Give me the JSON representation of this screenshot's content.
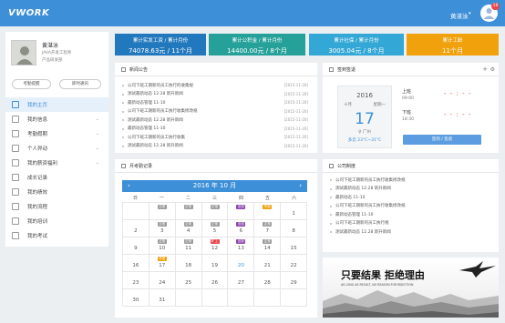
{
  "app": {
    "logo": "VWORK",
    "username": "黄湛泳",
    "notification_count": "18"
  },
  "profile": {
    "name": "黄湛泳",
    "line1": "JAVA开发工程师",
    "line2": "产品研发部",
    "btn_reminder": "考勤提醒",
    "btn_notice": "即时通讯"
  },
  "sidebar": {
    "items": [
      {
        "label": "我的主页",
        "active": true
      },
      {
        "label": "我的信息",
        "chevron": true
      },
      {
        "label": "考勤假期",
        "chevron": true
      },
      {
        "label": "个人异动",
        "chevron": true
      },
      {
        "label": "我的薪资福利",
        "chevron": true
      },
      {
        "label": "成长记录",
        "chevron": false
      },
      {
        "label": "我的绩效",
        "chevron": false
      },
      {
        "label": "我的流程",
        "chevron": false
      },
      {
        "label": "我的培训",
        "chevron": false
      },
      {
        "label": "我的考试",
        "chevron": false
      }
    ]
  },
  "stats": [
    {
      "title": "累计实发工资 / 累计月份",
      "value": "74078.63元 / 11个月",
      "color": "#2178bd"
    },
    {
      "title": "累计公积金 / 累计月份",
      "value": "14400.00元 / 8个月",
      "color": "#26a19a"
    },
    {
      "title": "累计社保 / 累计月份",
      "value": "3005.04元 / 8个月",
      "color": "#33a7d5"
    },
    {
      "title": "累计工龄",
      "value": "11个月",
      "color": "#f0a10c"
    }
  ],
  "news_panel": {
    "title": "新闻公告",
    "items": [
      {
        "text": "公司下班工期新的员工执行的收集规",
        "date": "[2015-11-20]"
      },
      {
        "text": "测试最新动态 12.28 新升新闻",
        "date": "[2015-11-20]"
      },
      {
        "text": "最新动态管理 11-10",
        "date": "[2015-11-20]"
      },
      {
        "text": "公司下班工期新的员工执行收集修改规",
        "date": "[2015-11-20]"
      },
      {
        "text": "测试最新动态 12.28 新升新闻",
        "date": "[2015-11-20]"
      },
      {
        "text": "最新动态管理 11-10",
        "date": "[2015-11-20]"
      },
      {
        "text": "公司下班工期新的员工执行收集",
        "date": "[2015-11-20]"
      },
      {
        "text": "测试最新动态 12.28 新升新闻",
        "date": "[2015-11-20]"
      }
    ]
  },
  "checkin_panel": {
    "title": "签到签退",
    "year": "2016",
    "month": "十月",
    "weekday": "星期一",
    "day": "17",
    "city": "♀ 广州",
    "weather": "多云 23°C~31°C",
    "on_label": "上班",
    "on_time": "09:00",
    "off_label": "下班",
    "off_time": "18:30",
    "placeholder": "- - : - -",
    "button": "签到 / 签退"
  },
  "calendar_panel": {
    "title": "月考勤记录",
    "month_title": "2016 年 10 月",
    "weekdays": [
      "日",
      "一",
      "二",
      "三",
      "四",
      "五",
      "六"
    ],
    "weeks": [
      [
        {
          "n": ""
        },
        {
          "n": "",
          "tag": "正常",
          "tc": "#9b9b9b"
        },
        {
          "n": "",
          "tag": "正常",
          "tc": "#9b9b9b"
        },
        {
          "n": "",
          "tag": "正常",
          "tc": "#9b9b9b"
        },
        {
          "n": "",
          "tag": "迟到",
          "tc": "#8e44ad"
        },
        {
          "n": "",
          "tag": "早退",
          "tc": "#f0a10c"
        },
        {
          "n": "1"
        }
      ],
      [
        {
          "n": "2"
        },
        {
          "n": "3",
          "tag": "正常",
          "tc": "#9b9b9b"
        },
        {
          "n": "4",
          "tag": "正常",
          "tc": "#9b9b9b"
        },
        {
          "n": "5",
          "tag": "正常",
          "tc": "#9b9b9b"
        },
        {
          "n": "6",
          "tag": "迟到",
          "tc": "#8e44ad"
        },
        {
          "n": "7",
          "tag": "正常",
          "tc": "#9b9b9b"
        },
        {
          "n": "8"
        }
      ],
      [
        {
          "n": "9"
        },
        {
          "n": "10",
          "tag": "正常",
          "tc": "#9b9b9b"
        },
        {
          "n": "11",
          "tag": "正常",
          "tc": "#9b9b9b"
        },
        {
          "n": "12",
          "tag": "旷工",
          "tc": "#e8474d"
        },
        {
          "n": "13",
          "tag": "迟到",
          "tc": "#8e44ad"
        },
        {
          "n": "14",
          "tag": "正常",
          "tc": "#9b9b9b"
        },
        {
          "n": "15"
        }
      ],
      [
        {
          "n": "16"
        },
        {
          "n": "17",
          "tag": "早退",
          "tc": "#f0a10c"
        },
        {
          "n": "18"
        },
        {
          "n": "19"
        },
        {
          "n": "20",
          "blue": true
        },
        {
          "n": "21"
        },
        {
          "n": "22"
        }
      ],
      [
        {
          "n": "23"
        },
        {
          "n": "24"
        },
        {
          "n": "25"
        },
        {
          "n": "26"
        },
        {
          "n": "27"
        },
        {
          "n": "28"
        },
        {
          "n": "29"
        }
      ],
      [
        {
          "n": "30"
        },
        {
          "n": "31"
        },
        {
          "n": ""
        },
        {
          "n": ""
        },
        {
          "n": ""
        },
        {
          "n": ""
        },
        {
          "n": ""
        }
      ]
    ]
  },
  "rules_panel": {
    "title": "公司制度",
    "items": [
      "公司下班工期新的员工执行收集修改规",
      "测试最新动态 12.28 新升新闻",
      "最新动态 11-10",
      "公司下班工期新的员工执行收集修改规",
      "最新动态管理 11-10",
      "公司下班工期新的员工执行规",
      "测试最新动态 12.28 新升新闻"
    ]
  },
  "banner": {
    "slogan_big": "只要结果 拒绝理由",
    "slogan_small": "AS LONG AS RESULT, NO REASON FOR REJECTION"
  }
}
